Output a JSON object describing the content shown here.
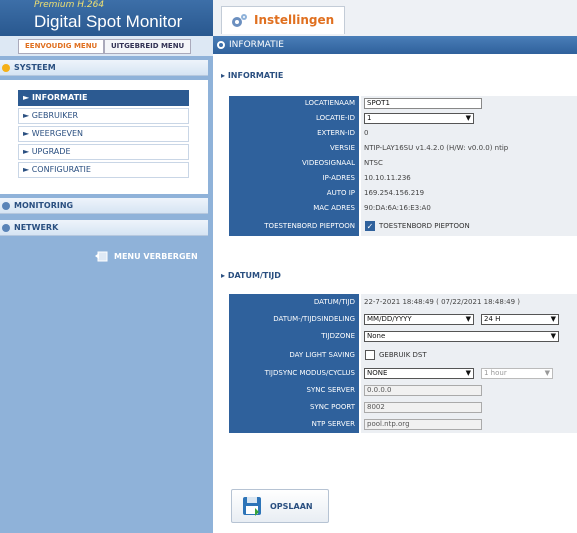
{
  "brand": {
    "sub": "Premium H.264",
    "title": "Digital Spot Monitor"
  },
  "menu_tabs": {
    "simple": "EENVOUDIG MENU",
    "advanced": "UITGEBREID MENU"
  },
  "sidebar": {
    "systeem": "SYSTEEM",
    "items": [
      "► INFORMATIE",
      "► GEBRUIKER",
      "► WEERGEVEN",
      "► UPGRADE",
      "► CONFIGURATIE"
    ],
    "monitoring": "MONITORING",
    "netwerk": "NETWERK",
    "hide_menu": "MENU VERBERGEN"
  },
  "page_tab": "Instellingen",
  "content_title": "INFORMATIE",
  "info": {
    "title": "INFORMATIE",
    "locatienaam_label": "LOCATIENAAM",
    "locatienaam_value": "SPOT1",
    "locatieid_label": "LOCATIE-ID",
    "locatieid_value": "1",
    "externid_label": "EXTERN-ID",
    "externid_value": "0",
    "versie_label": "VERSIE",
    "versie_value": "NTIP-LAY16SU v1.4.2.0 (H/W: v0.0.0) ntip",
    "video_label": "VIDEOSIGNAAL",
    "video_value": "NTSC",
    "ip_label": "IP-ADRES",
    "ip_value": "10.10.11.236",
    "autoip_label": "AUTO IP",
    "autoip_value": "169.254.156.219",
    "mac_label": "MAC ADRES",
    "mac_value": "90:DA:6A:16:E3:A0",
    "piep_label": "TOESTENBORD PIEPTOON",
    "piep_check_label": "TOESTENBORD PIEPTOON"
  },
  "datetime": {
    "title": "DATUM/TIJD",
    "dt_label": "DATUM/TIJD",
    "dt_value": "22-7-2021 18:48:49  ( 07/22/2021  18:48:49 )",
    "fmt_label": "DATUM-/TIJDSINDELING",
    "fmt_date": "MM/DD/YYYY",
    "fmt_time": "24 H",
    "tz_label": "TIJDZONE",
    "tz_value": "None",
    "dst_label": "DAY LIGHT SAVING",
    "dst_check_label": "GEBRUIK DST",
    "sync_mode_label": "TIJDSYNC MODUS/CYCLUS",
    "sync_mode_value": "NONE",
    "sync_cycle_value": "1 hour",
    "sync_server_label": "SYNC SERVER",
    "sync_server_value": "0.0.0.0",
    "sync_port_label": "SYNC POORT",
    "sync_port_value": "8002",
    "ntp_label": "NTP SERVER",
    "ntp_value": "pool.ntp.org"
  },
  "save_label": "OPSLAAN"
}
